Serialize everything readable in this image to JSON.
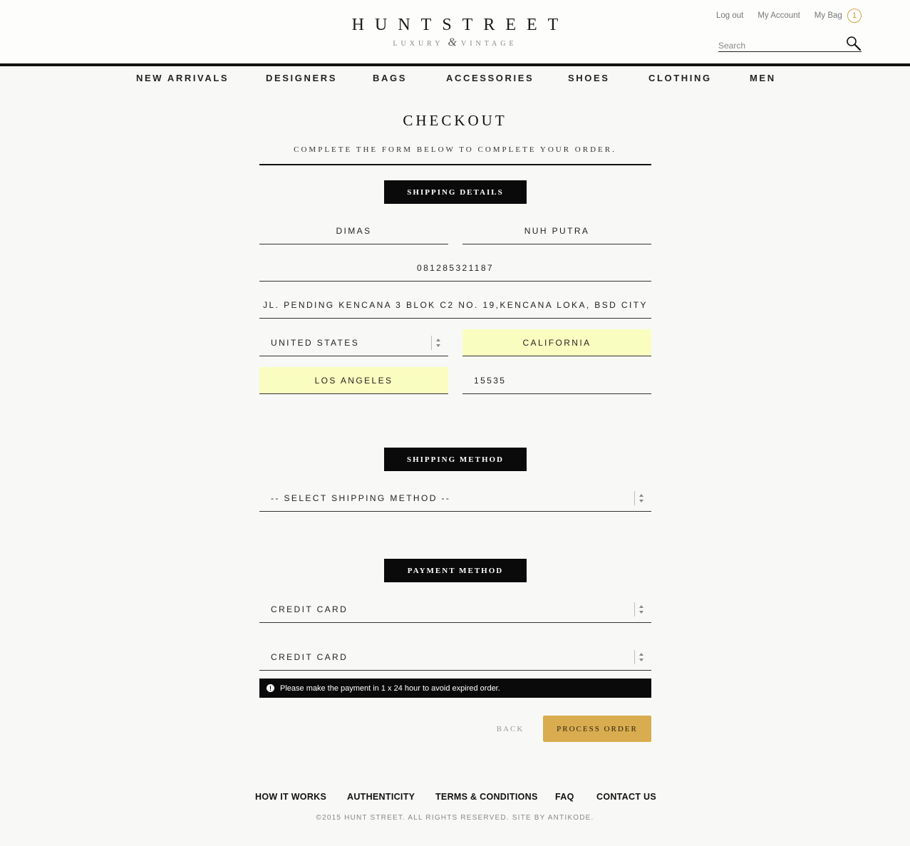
{
  "header": {
    "logo_title": "HUNTSTREET",
    "logo_sub_left": "LUXURY",
    "logo_sub_amp": "&",
    "logo_sub_right": "VINTAGE",
    "top_links": {
      "logout": "Log out",
      "account": "My Account",
      "bag": "My Bag",
      "bag_count": "1"
    },
    "search": {
      "placeholder": "Search"
    }
  },
  "nav": [
    "NEW ARRIVALS",
    "DESIGNERS",
    "BAGS",
    "ACCESSORIES",
    "SHOES",
    "CLOTHING",
    "MEN"
  ],
  "checkout": {
    "title": "CHECKOUT",
    "subtitle": "COMPLETE THE FORM BELOW TO COMPLETE YOUR ORDER."
  },
  "shipping_details": {
    "label": "SHIPPING DETAILS",
    "first_name": "DIMAS",
    "last_name": "NUH PUTRA",
    "phone": "081285321187",
    "address": "JL. PENDING KENCANA 3 BLOK C2 NO. 19,KENCANA LOKA, BSD CITY",
    "country": "UNITED STATES",
    "state": "CALIFORNIA",
    "city": "LOS ANGELES",
    "zip": "15535"
  },
  "shipping_method": {
    "label": "SHIPPING METHOD",
    "selected": "-- SELECT SHIPPING METHOD --"
  },
  "payment_method": {
    "label": "PAYMENT METHOD",
    "selected": "CREDIT CARD",
    "sub_selected": "CREDIT CARD",
    "notice": "Please make the payment in 1 x 24 hour to avoid expired order."
  },
  "actions": {
    "back": "BACK",
    "process": "PROCESS ORDER"
  },
  "footer": {
    "links": [
      "HOW IT WORKS",
      "AUTHENTICITY",
      "TERMS & CONDITIONS",
      "FAQ",
      "CONTACT US"
    ],
    "copyright": "©2015 HUNT STREET. ALL RIGHTS RESERVED. SITE BY ANTIKODE."
  },
  "colors": {
    "accent": "#d9ac4f",
    "highlight": "#fafdc0",
    "dark": "#0a0a0a"
  }
}
